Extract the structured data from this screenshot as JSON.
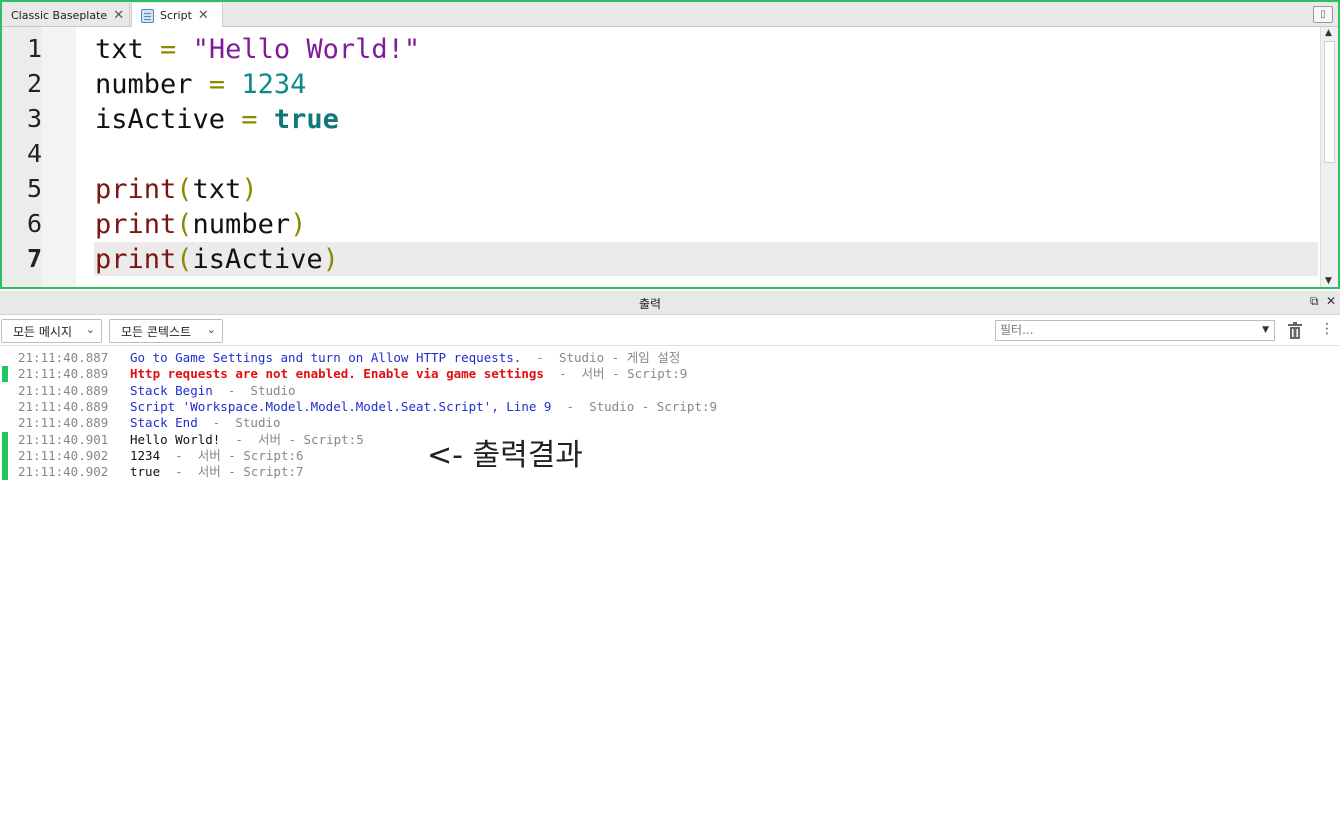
{
  "tabs": [
    {
      "label": "Classic Baseplate"
    },
    {
      "label": "Script"
    }
  ],
  "editor": {
    "line_numbers": [
      "1",
      "2",
      "3",
      "4",
      "5",
      "6",
      "7"
    ],
    "current_line": "7",
    "lines": [
      {
        "parts": [
          {
            "text": "txt",
            "kind": "ident"
          },
          {
            "text": " = ",
            "kind": "op"
          },
          {
            "text": "\"Hello World!\"",
            "kind": "str"
          }
        ]
      },
      {
        "parts": [
          {
            "text": "number",
            "kind": "ident"
          },
          {
            "text": " = ",
            "kind": "op"
          },
          {
            "text": "1234",
            "kind": "num"
          }
        ]
      },
      {
        "parts": [
          {
            "text": "isActive",
            "kind": "ident"
          },
          {
            "text": " = ",
            "kind": "op"
          },
          {
            "text": "true",
            "kind": "bool"
          }
        ]
      },
      {
        "parts": []
      },
      {
        "parts": [
          {
            "text": "print",
            "kind": "fn"
          },
          {
            "text": "(",
            "kind": "paren"
          },
          {
            "text": "txt",
            "kind": "ident"
          },
          {
            "text": ")",
            "kind": "paren"
          }
        ]
      },
      {
        "parts": [
          {
            "text": "print",
            "kind": "fn"
          },
          {
            "text": "(",
            "kind": "paren"
          },
          {
            "text": "number",
            "kind": "ident"
          },
          {
            "text": ")",
            "kind": "paren"
          }
        ]
      },
      {
        "parts": [
          {
            "text": "print",
            "kind": "fn"
          },
          {
            "text": "(",
            "kind": "paren"
          },
          {
            "text": "isActive",
            "kind": "ident"
          },
          {
            "text": ")",
            "kind": "paren"
          }
        ]
      }
    ]
  },
  "output": {
    "title": "출력",
    "message_filter": "모든 메시지",
    "context_filter": "모든 콘텍스트",
    "filter_placeholder": "필터...",
    "logs": [
      {
        "time": "21:11:40.887",
        "marker": false,
        "kind": "info",
        "message": "Go to Game Settings and turn on Allow HTTP requests.",
        "source": "  -  Studio - 게임 설정"
      },
      {
        "time": "21:11:40.889",
        "marker": true,
        "kind": "error",
        "message": "Http requests are not enabled. Enable via game settings",
        "source": "  -  서버 - Script:9"
      },
      {
        "time": "21:11:40.889",
        "marker": false,
        "kind": "info",
        "message": "Stack Begin",
        "source": "  -  Studio"
      },
      {
        "time": "21:11:40.889",
        "marker": false,
        "kind": "info",
        "message": "Script 'Workspace.Model.Model.Model.Seat.Script', Line 9",
        "source": "  -  Studio - Script:9"
      },
      {
        "time": "21:11:40.889",
        "marker": false,
        "kind": "info",
        "message": "Stack End",
        "source": "  -  Studio"
      },
      {
        "time": "21:11:40.901",
        "marker": true,
        "kind": "plain",
        "message": "Hello World!",
        "source": "  -  서버 - Script:5"
      },
      {
        "time": "21:11:40.902",
        "marker": true,
        "kind": "plain",
        "message": "1234",
        "source": "  -  서버 - Script:6"
      },
      {
        "time": "21:11:40.902",
        "marker": true,
        "kind": "plain",
        "message": "true",
        "source": "  -  서버 - Script:7"
      }
    ]
  },
  "annotation": "<- 출력결과",
  "colors": {
    "accent_border": "#2fbf63",
    "log_marker": "#22c55e",
    "info_text": "#1f2ecf",
    "error_text": "#e01010"
  }
}
